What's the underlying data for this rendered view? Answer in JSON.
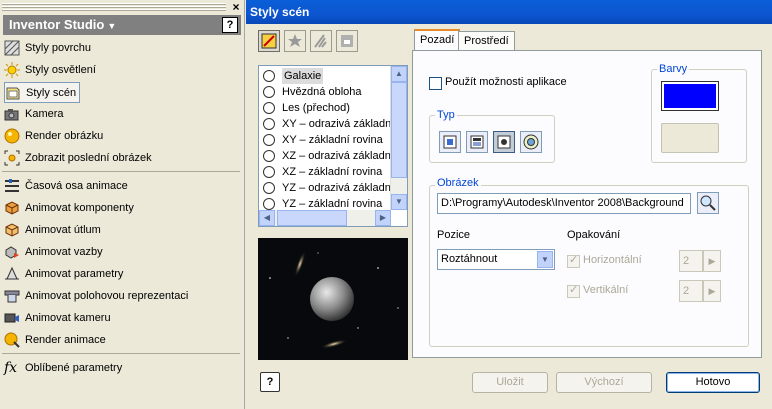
{
  "left_panel": {
    "header_title": "Inventor Studio",
    "help_label": "?",
    "close_label": "×",
    "items": [
      {
        "label": "Styly povrchu",
        "icon": "surface-styles-icon"
      },
      {
        "label": "Styly osvětlení",
        "icon": "lighting-styles-icon"
      },
      {
        "label": "Styly scén",
        "icon": "scene-styles-icon",
        "selected": true
      },
      {
        "label": "Kamera",
        "icon": "camera-icon"
      },
      {
        "label": "Render obrázku",
        "icon": "render-image-icon"
      },
      {
        "label": "Zobrazit poslední obrázek",
        "icon": "show-last-image-icon"
      },
      {
        "label": "Časová osa animace",
        "icon": "animation-timeline-icon"
      },
      {
        "label": "Animovat komponenty",
        "icon": "animate-components-icon"
      },
      {
        "label": "Animovat útlum",
        "icon": "animate-fade-icon"
      },
      {
        "label": "Animovat vazby",
        "icon": "animate-constraints-icon"
      },
      {
        "label": "Animovat parametry",
        "icon": "animate-parameters-icon"
      },
      {
        "label": "Animovat polohovou reprezentaci",
        "icon": "animate-positional-rep-icon"
      },
      {
        "label": "Animovat kameru",
        "icon": "animate-camera-icon"
      },
      {
        "label": "Render animace",
        "icon": "render-animation-icon"
      },
      {
        "label": "Oblíbené parametry",
        "icon": "favorite-parameters-icon"
      }
    ]
  },
  "dialog": {
    "title": "Styly scén",
    "styles": [
      "Galaxie",
      "Hvězdná obloha",
      "Les (přechod)",
      "XY – odrazivá základní",
      "XY – základní rovina",
      "XZ – odrazivá základní",
      "XZ – základní rovina",
      "YZ – odrazivá základní",
      "YZ – základní rovina"
    ],
    "selected_style": "Galaxie",
    "tabs": [
      "Pozadí",
      "Prostředí"
    ],
    "active_tab": "Pozadí",
    "use_app_options_label": "Použít možnosti aplikace",
    "typ_label": "Typ",
    "barvy_label": "Barvy",
    "color_primary": "#0000ff",
    "color_secondary": "#ece9d8",
    "obrazek_label": "Obrázek",
    "image_path": "D:\\Programy\\Autodesk\\Inventor 2008\\Background",
    "pozice_label": "Pozice",
    "pozice_value": "Roztáhnout",
    "opakovani_label": "Opakování",
    "horizontal_label": "Horizontální",
    "horizontal_value": "2",
    "vertical_label": "Vertikální",
    "vertical_value": "2",
    "buttons": {
      "help": "?",
      "save": "Uložit",
      "default": "Výchozí",
      "done": "Hotovo"
    }
  }
}
